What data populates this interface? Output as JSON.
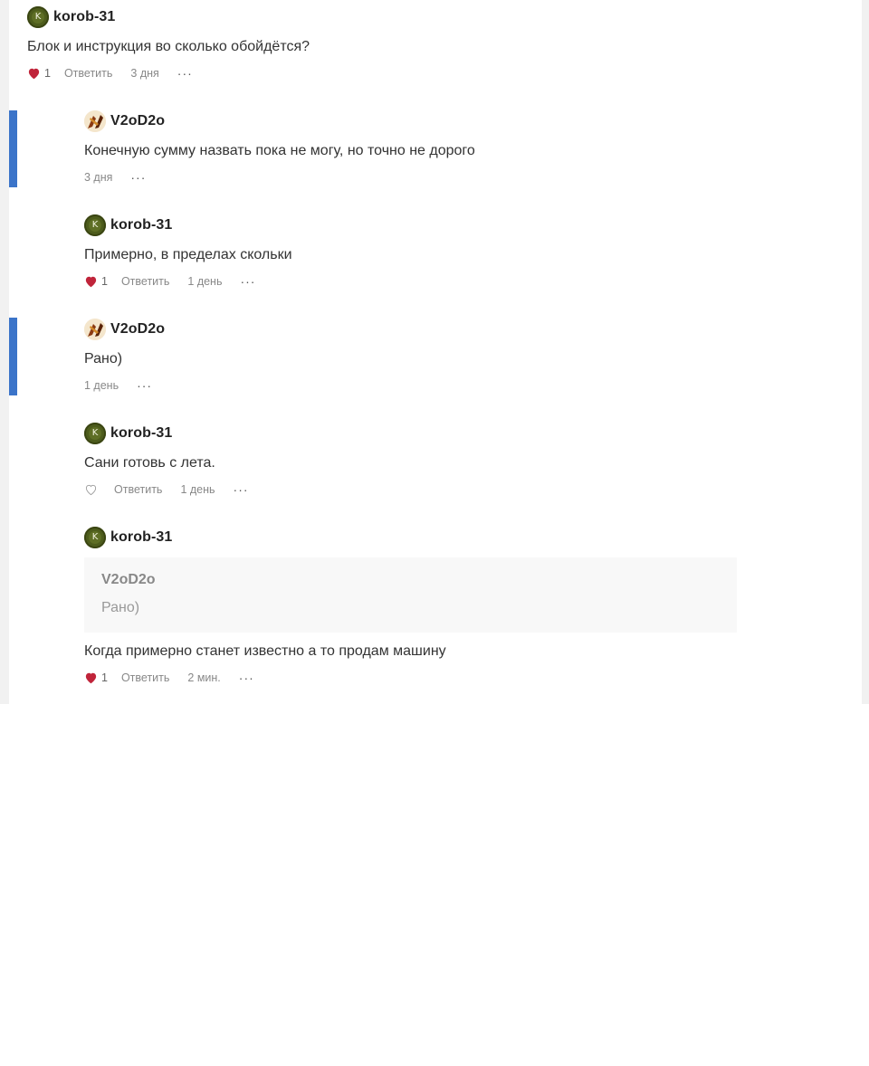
{
  "comments": [
    {
      "author": "korob-31",
      "text": "Блок и инструкция во сколько обойдётся?",
      "likes": "1",
      "reply": "Ответить",
      "time": "3 дня",
      "more": "···"
    },
    {
      "author": "V2oD2o",
      "text": "Конечную сумму назвать пока не могу, но точно не дорого",
      "time": "3 дня",
      "more": "···"
    },
    {
      "author": "korob-31",
      "text": "Примерно, в пределах скольки",
      "likes": "1",
      "reply": "Ответить",
      "time": "1 день",
      "more": "···"
    },
    {
      "author": "V2oD2o",
      "text": "Рано)",
      "time": "1 день",
      "more": "···"
    },
    {
      "author": "korob-31",
      "text": "Сани готовь с лета.",
      "reply": "Ответить",
      "time": "1 день",
      "more": "···"
    },
    {
      "author": "korob-31",
      "quote": {
        "author": "V2oD2o",
        "text": "Рано)"
      },
      "text": "Когда примерно станет известно а то продам машину",
      "likes": "1",
      "reply": "Ответить",
      "time": "2 мин.",
      "more": "···"
    }
  ],
  "avatar_initial": "K",
  "colors": {
    "heart_filled": "#c0243a",
    "accent_bar": "#3b74c9",
    "avatar_green": "#4d5c1c"
  }
}
